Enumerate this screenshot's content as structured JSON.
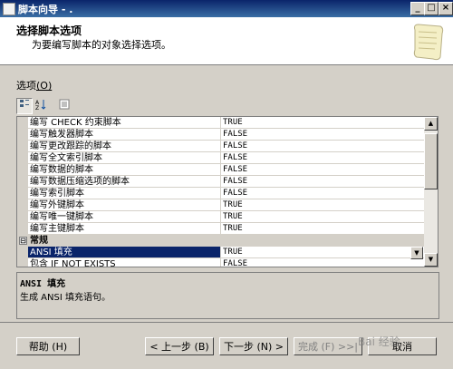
{
  "window": {
    "title": "脚本向导 - .",
    "min_label": "_",
    "max_label": "□",
    "close_label": "×"
  },
  "header": {
    "title": "选择脚本选项",
    "subtitle": "为要编写脚本的对象选择选项。"
  },
  "options": {
    "label": "选项",
    "mnemonic": "(O)"
  },
  "grid": {
    "rows": [
      {
        "name": "编写 CHECK 约束脚本",
        "value": "TRUE"
      },
      {
        "name": "编写触发器脚本",
        "value": "FALSE"
      },
      {
        "name": "编写更改跟踪的脚本",
        "value": "FALSE"
      },
      {
        "name": "编写全文索引脚本",
        "value": "FALSE"
      },
      {
        "name": "编写数据的脚本",
        "value": "FALSE"
      },
      {
        "name": "编写数据压缩选项的脚本",
        "value": "FALSE"
      },
      {
        "name": "编写索引脚本",
        "value": "FALSE"
      },
      {
        "name": "编写外键脚本",
        "value": "TRUE"
      },
      {
        "name": "编写唯一键脚本",
        "value": "TRUE"
      },
      {
        "name": "编写主键脚本",
        "value": "TRUE"
      }
    ],
    "category": {
      "expander": "⊟",
      "name": "常规"
    },
    "selected": {
      "name": "ANSI 填充",
      "value": "TRUE"
    },
    "partial": {
      "name": "包含 IF NOT EXISTS",
      "value": "FALSE"
    }
  },
  "description": {
    "title": "ANSI 填充",
    "text": "生成 ANSI 填充语句。"
  },
  "buttons": {
    "help": "帮助 (H)",
    "back": "< 上一步 (B)",
    "next": "下一步 (N) >",
    "finish": "完成 (F) >>|",
    "cancel": "取消"
  },
  "watermark": "Bai 经验"
}
